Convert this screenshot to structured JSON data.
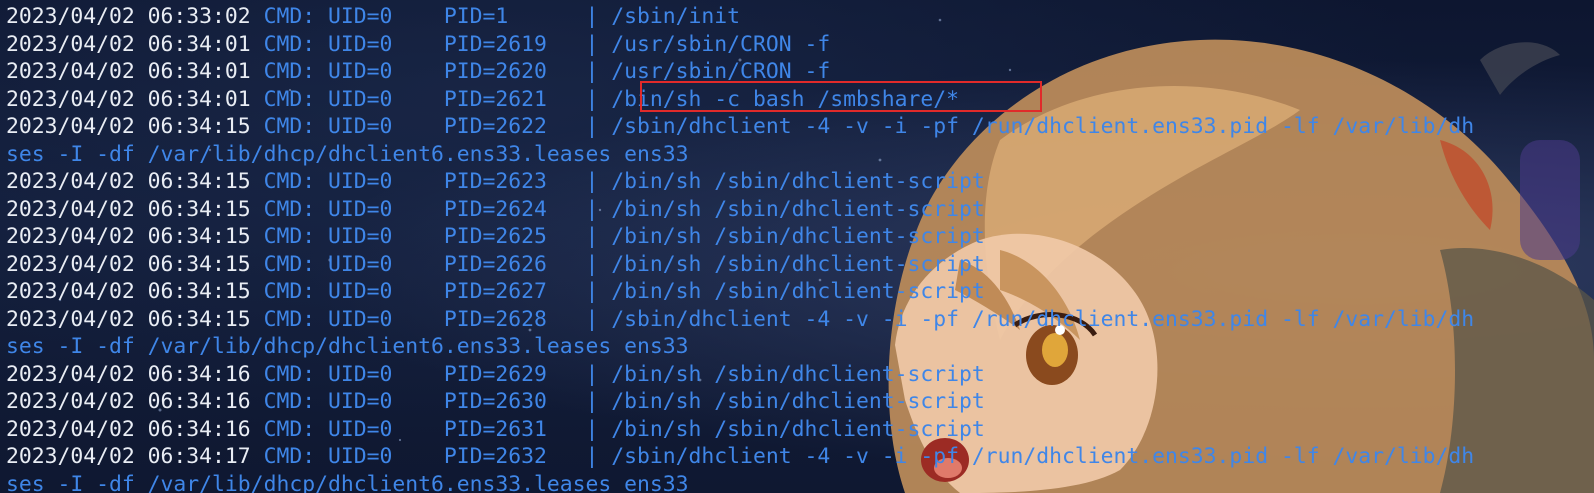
{
  "terminal": {
    "lines": [
      {
        "ts": "2023/04/02 06:33:02",
        "cmd": " CMD: UID=0    PID=1      | /sbin/init"
      },
      {
        "ts": "2023/04/02 06:34:01",
        "cmd": " CMD: UID=0    PID=2619   | /usr/sbin/CRON -f"
      },
      {
        "ts": "2023/04/02 06:34:01",
        "cmd": " CMD: UID=0    PID=2620   | /usr/sbin/CRON -f"
      },
      {
        "ts": "2023/04/02 06:34:01",
        "cmd": " CMD: UID=0    PID=2621   | /bin/sh -c bash /smbshare/*"
      },
      {
        "ts": "2023/04/02 06:34:15",
        "cmd": " CMD: UID=0    PID=2622   | /sbin/dhclient -4 -v -i -pf /run/dhclient.ens33.pid -lf /var/lib/dh"
      },
      {
        "ts": "",
        "cmd": "ses -I -df /var/lib/dhcp/dhclient6.ens33.leases ens33"
      },
      {
        "ts": "2023/04/02 06:34:15",
        "cmd": " CMD: UID=0    PID=2623   | /bin/sh /sbin/dhclient-script"
      },
      {
        "ts": "2023/04/02 06:34:15",
        "cmd": " CMD: UID=0    PID=2624   | /bin/sh /sbin/dhclient-script"
      },
      {
        "ts": "2023/04/02 06:34:15",
        "cmd": " CMD: UID=0    PID=2625   | /bin/sh /sbin/dhclient-script"
      },
      {
        "ts": "2023/04/02 06:34:15",
        "cmd": " CMD: UID=0    PID=2626   | /bin/sh /sbin/dhclient-script"
      },
      {
        "ts": "2023/04/02 06:34:15",
        "cmd": " CMD: UID=0    PID=2627   | /bin/sh /sbin/dhclient-script"
      },
      {
        "ts": "2023/04/02 06:34:15",
        "cmd": " CMD: UID=0    PID=2628   | /sbin/dhclient -4 -v -i -pf /run/dhclient.ens33.pid -lf /var/lib/dh"
      },
      {
        "ts": "",
        "cmd": "ses -I -df /var/lib/dhcp/dhclient6.ens33.leases ens33"
      },
      {
        "ts": "2023/04/02 06:34:16",
        "cmd": " CMD: UID=0    PID=2629   | /bin/sh /sbin/dhclient-script"
      },
      {
        "ts": "2023/04/02 06:34:16",
        "cmd": " CMD: UID=0    PID=2630   | /bin/sh /sbin/dhclient-script"
      },
      {
        "ts": "2023/04/02 06:34:16",
        "cmd": " CMD: UID=0    PID=2631   | /bin/sh /sbin/dhclient-script"
      },
      {
        "ts": "2023/04/02 06:34:17",
        "cmd": " CMD: UID=0    PID=2632   | /sbin/dhclient -4 -v -i -pf /run/dhclient.ens33.pid -lf /var/lib/dh"
      },
      {
        "ts": "",
        "cmd": "ses -I -df /var/lib/dhcp/dhclient6.ens33.leases ens33"
      }
    ]
  },
  "colors": {
    "timestamp": "#e9edf4",
    "command": "#3f86e8",
    "highlight_border": "#e02a2a",
    "background": "#121d3a"
  },
  "background_art": {
    "icon": "anime-character-wallpaper"
  }
}
